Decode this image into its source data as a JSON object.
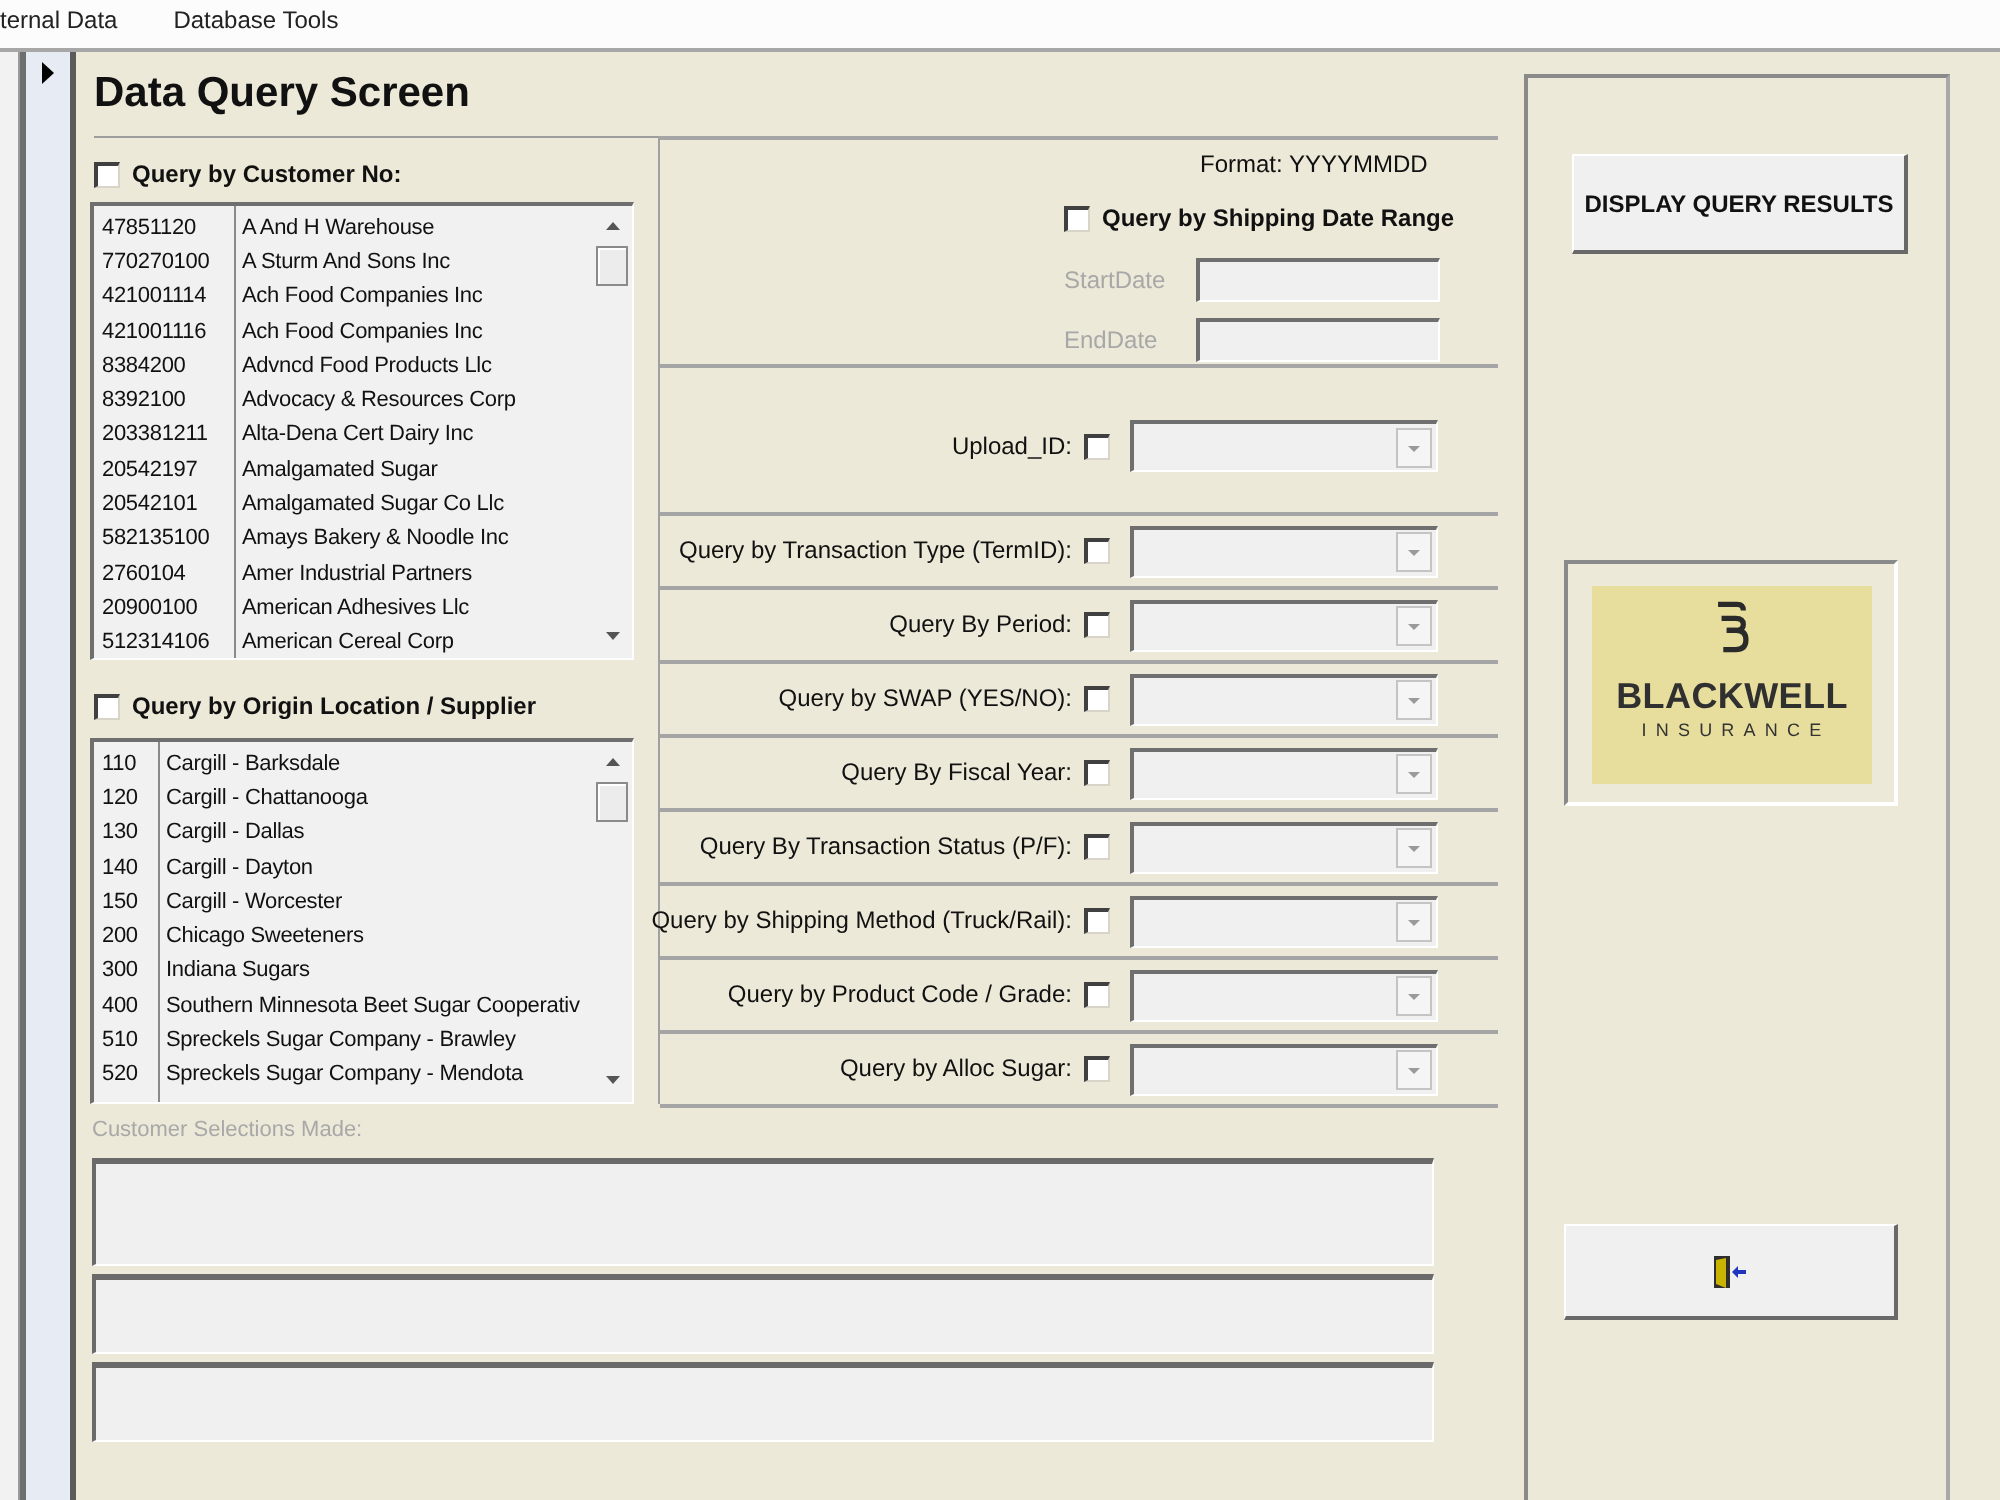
{
  "menu_bar": {
    "items": [
      "ternal Data",
      "Database Tools"
    ]
  },
  "form": {
    "title": "Data Query Screen"
  },
  "customer_query": {
    "label": "Query by Customer No:",
    "checked": false,
    "rows": [
      {
        "code": "47851120",
        "name": "A And H Warehouse"
      },
      {
        "code": "770270100",
        "name": "A Sturm And Sons Inc"
      },
      {
        "code": "421001114",
        "name": "Ach Food Companies Inc"
      },
      {
        "code": "421001116",
        "name": "Ach Food Companies Inc"
      },
      {
        "code": "8384200",
        "name": "Advncd Food Products Llc"
      },
      {
        "code": "8392100",
        "name": "Advocacy & Resources Corp"
      },
      {
        "code": "203381211",
        "name": "Alta-Dena Cert Dairy Inc"
      },
      {
        "code": "20542197",
        "name": "Amalgamated Sugar"
      },
      {
        "code": "20542101",
        "name": "Amalgamated Sugar Co Llc"
      },
      {
        "code": "582135100",
        "name": "Amays Bakery & Noodle Inc"
      },
      {
        "code": "2760104",
        "name": "Amer Industrial Partners"
      },
      {
        "code": "20900100",
        "name": "American Adhesives Llc"
      },
      {
        "code": "512314106",
        "name": "American Cereal Corp"
      }
    ]
  },
  "origin_query": {
    "label": "Query by Origin Location / Supplier",
    "checked": false,
    "rows": [
      {
        "code": "110",
        "name": "Cargill - Barksdale"
      },
      {
        "code": "120",
        "name": "Cargill - Chattanooga"
      },
      {
        "code": "130",
        "name": "Cargill - Dallas"
      },
      {
        "code": "140",
        "name": "Cargill - Dayton"
      },
      {
        "code": "150",
        "name": "Cargill - Worcester"
      },
      {
        "code": "200",
        "name": "Chicago Sweeteners"
      },
      {
        "code": "300",
        "name": "Indiana Sugars"
      },
      {
        "code": "400",
        "name": "Southern Minnesota Beet Sugar Cooperativ"
      },
      {
        "code": "510",
        "name": "Spreckels Sugar Company - Brawley"
      },
      {
        "code": "520",
        "name": "Spreckels Sugar Company - Mendota"
      }
    ]
  },
  "selections": {
    "label": "Customer Selections Made:",
    "disabled": true,
    "fields": [
      {
        "kind": "tall"
      },
      {
        "kind": "short"
      },
      {
        "kind": "short"
      }
    ]
  },
  "date_range": {
    "format_note": "Format: YYYYMMDD",
    "label": "Query by Shipping Date Range",
    "checked": false,
    "fields": [
      {
        "label": "StartDate",
        "disabled": true
      },
      {
        "label": "EndDate",
        "disabled": true
      }
    ]
  },
  "upload_filter": {
    "label": "Upload_ID:",
    "checked": false
  },
  "filters": [
    {
      "label": "Query by Transaction Type (TermID):",
      "checked": false
    },
    {
      "label": "Query By Period:",
      "checked": false
    },
    {
      "label": "Query by SWAP (YES/NO):",
      "checked": false
    },
    {
      "label": "Query By Fiscal Year:",
      "checked": false
    },
    {
      "label": "Query By Transaction Status (P/F):",
      "checked": false
    },
    {
      "label": "Query by Shipping Method (Truck/Rail):",
      "checked": false
    },
    {
      "label": "Query by Product Code / Grade:",
      "checked": false
    },
    {
      "label": "Query by Alloc Sugar:",
      "checked": false
    }
  ],
  "actions": {
    "display_button": "DISPLAY QUERY RESULTS"
  },
  "logo": {
    "name": "BLACKWELL",
    "tagline": "INSURANCE"
  }
}
